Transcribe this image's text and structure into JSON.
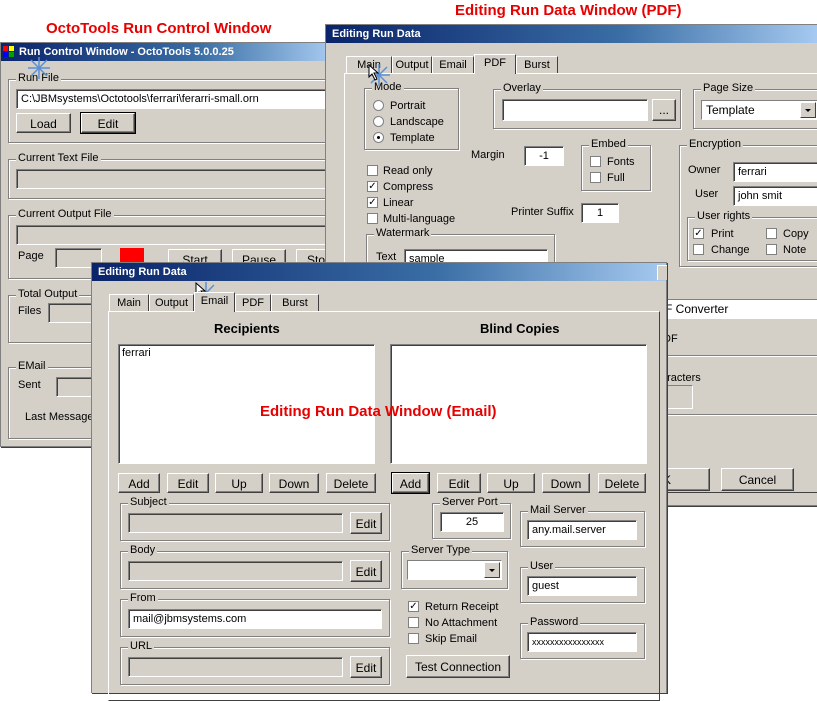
{
  "captions": {
    "run_control": "OctoTools Run Control Window",
    "pdf": "Editing Run Data Window (PDF)",
    "email": "Editing Run Data Window (Email)"
  },
  "run_control": {
    "title": "Run Control Window - OctoTools 5.0.0.25",
    "run_file_label": "Run File",
    "run_file_value": "C:\\JBMsystems\\Octotools\\ferrari\\ferarri-small.orn",
    "load_button": "Load",
    "edit_button": "Edit",
    "current_text_file_label": "Current Text File",
    "current_output_file_label": "Current Output File",
    "page_label": "Page",
    "start_button": "Start",
    "pause_button": "Pause",
    "stop_button": "Sto",
    "total_output_label": "Total Output",
    "files_label": "Files",
    "email_label": "EMail",
    "sent_label": "Sent",
    "last_message_label": "Last Message",
    "indicator_color": "#ff0000"
  },
  "pdf_window": {
    "title": "Editing Run Data",
    "tabs": [
      "Main",
      "Output",
      "Email",
      "PDF",
      "Burst"
    ],
    "active_tab": "PDF",
    "mode_label": "Mode",
    "mode_options": [
      "Portrait",
      "Landscape",
      "Template"
    ],
    "mode_selected": "Template",
    "overlay_label": "Overlay",
    "overlay_value": "",
    "browse_button": "...",
    "page_size_label": "Page Size",
    "page_size_value": "Template",
    "read_only_label": "Read only",
    "compress_label": "Compress",
    "linear_label": "Linear",
    "multi_language_label": "Multi-language",
    "margin_label": "Margin",
    "margin_value": "-1",
    "embed_label": "Embed",
    "fonts_label": "Fonts",
    "full_label": "Full",
    "printer_suffix_label": "Printer Suffix",
    "printer_suffix_value": "1",
    "encryption_label": "Encryption",
    "owner_label": "Owner",
    "owner_value": "ferrari",
    "user_label": "User",
    "user_value": "john smit",
    "user_rights_label": "User rights",
    "print_label": "Print",
    "copy_label": "Copy",
    "change_label": "Change",
    "note_label": "Note",
    "watermark_label": "Watermark",
    "text_label": "Text",
    "watermark_text_value": "sample",
    "converter_value": "F Converter",
    "df_fragment": "DF",
    "characters_fragment": "aracters",
    "ok_button": "K",
    "cancel_button": "Cancel"
  },
  "email_window": {
    "title": "Editing Run Data",
    "tabs": [
      "Main",
      "Output",
      "Email",
      "PDF",
      "Burst"
    ],
    "active_tab": "Email",
    "recipients_header": "Recipients",
    "blind_copies_header": "Blind Copies",
    "recipients": [
      "ferrari"
    ],
    "blind_copies": [],
    "add_button": "Add",
    "edit_button": "Edit",
    "up_button": "Up",
    "down_button": "Down",
    "delete_button": "Delete",
    "subject_label": "Subject",
    "subject_value": "",
    "body_label": "Body",
    "body_value": "",
    "from_label": "From",
    "from_value": "mail@jbmsystems.com",
    "url_label": "URL",
    "url_value": "",
    "server_port_label": "Server Port",
    "server_port_value": "25",
    "server_type_label": "Server Type",
    "server_type_value": "",
    "mail_server_label": "Mail Server",
    "mail_server_value": "any.mail.server",
    "user_label": "User",
    "user_value": "guest",
    "password_label": "Password",
    "password_value": "xxxxxxxxxxxxxxxx",
    "return_receipt_label": "Return Receipt",
    "no_attachment_label": "No Attachment",
    "skip_email_label": "Skip Email",
    "test_connection_button": "Test Connection"
  }
}
